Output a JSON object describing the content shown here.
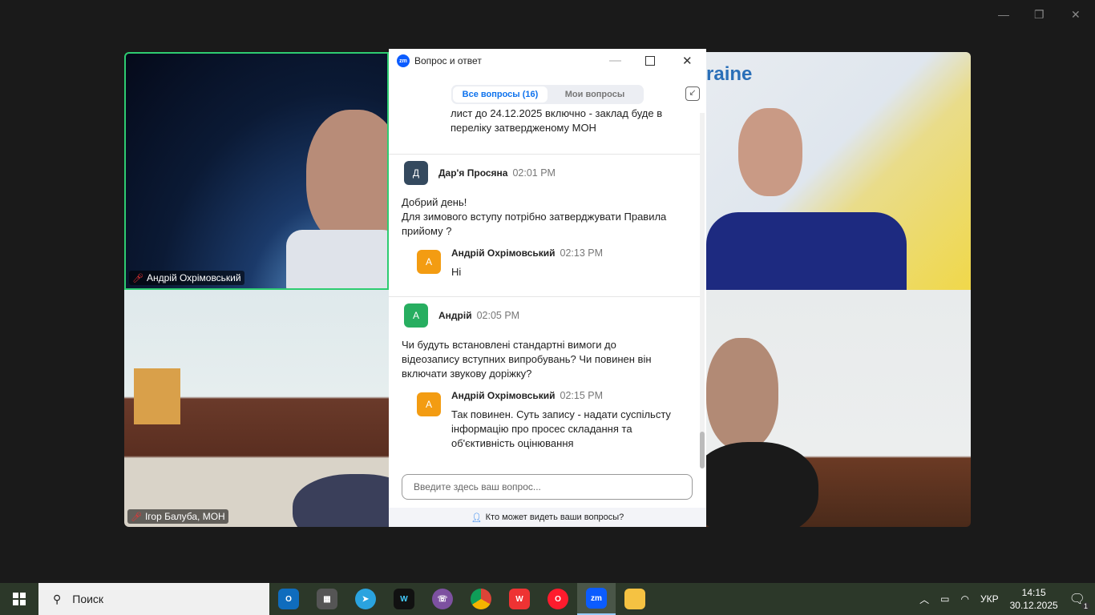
{
  "window": {
    "minimize": "—",
    "maximize": "❐",
    "close": "✕"
  },
  "tiles": [
    {
      "name": "Андрій Охрімовський",
      "muted": true
    },
    {
      "name": "Ігор Балуба, МОН",
      "muted": true
    },
    {
      "banner": "raine"
    }
  ],
  "qa": {
    "title": "Вопрос и ответ",
    "logo": "zm",
    "tabs": [
      "Все вопросы (16)",
      "Мои вопросы"
    ],
    "prev_text": [
      "лист до 24.12.2025 включно - заклад буде в",
      "переліку затвердженому МОН"
    ],
    "questions": [
      {
        "initial": "Д",
        "author": "Дар'я Просяна",
        "time": "02:01 PM",
        "text": [
          "Добрий день!",
          "Для зимового вступу потрібно затверджувати Правила",
          "прийому ?"
        ],
        "avatar_color": "#34495e",
        "answer": {
          "initial": "А",
          "author": "Андрій Охрімовський",
          "time": "02:13 PM",
          "text": [
            "Ні"
          ]
        }
      },
      {
        "initial": "А",
        "author": "Андрій",
        "time": "02:05 PM",
        "text": [
          "Чи будуть встановлені стандартні вимоги до",
          "відеозапису вступних випробувань? Чи повинен він",
          "включати звукову доріжку?"
        ],
        "avatar_color": "#27ae60",
        "answer": {
          "initial": "А",
          "author": "Андрій Охрімовський",
          "time": "02:15 PM",
          "text": [
            "Так повинен. Суть запису - надати суспільсту",
            "інформацію про просес складання та",
            "об'єктивність оцінювання"
          ]
        }
      }
    ],
    "input_placeholder": "Введите здесь ваш вопрос...",
    "footer": "Кто может видеть ваши вопросы?"
  },
  "taskbar": {
    "search": "Поиск",
    "apps": [
      "Outlook",
      "Store",
      "Telegram",
      "Wondershare",
      "Viber",
      "Chrome",
      "WPS",
      "Opera",
      "Zoom",
      "Explorer"
    ],
    "lang": "УКР",
    "time": "14:15",
    "date": "30.12.2025",
    "notifications": "1"
  }
}
